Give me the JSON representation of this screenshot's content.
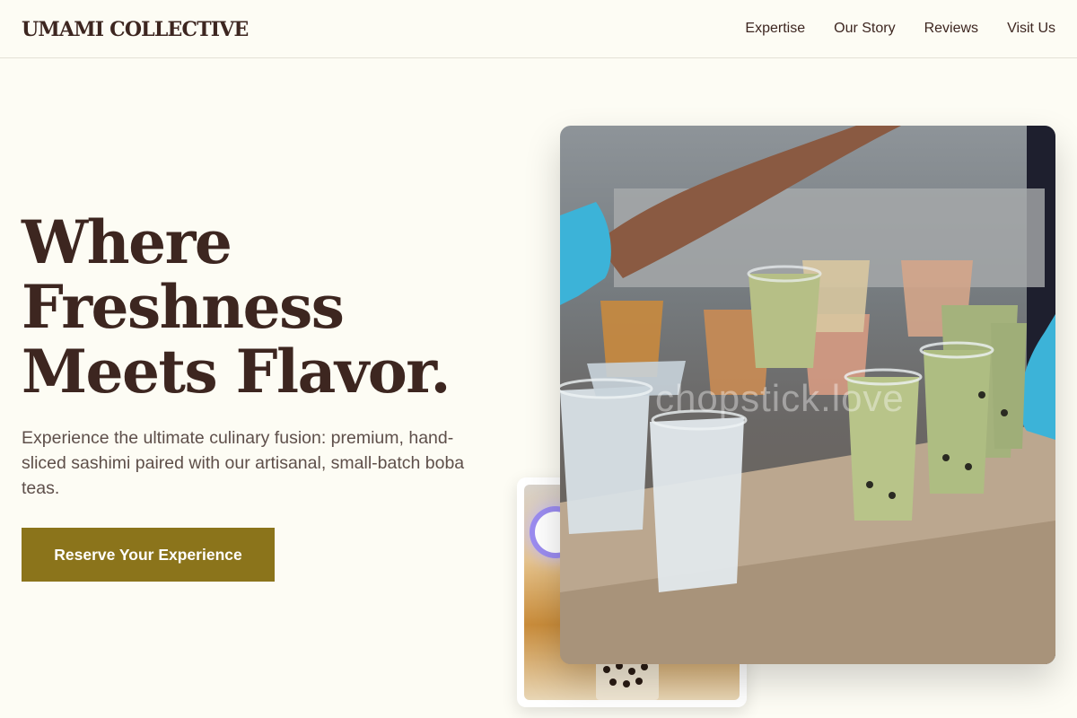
{
  "header": {
    "logo": "UMAMI COLLECTIVE",
    "nav": [
      "Expertise",
      "Our Story",
      "Reviews",
      "Visit Us"
    ]
  },
  "hero": {
    "title_lines": [
      "Where",
      "Freshness",
      "Meets Flavor."
    ],
    "description": "Experience the ultimate culinary fusion: premium, hand-sliced sashimi paired with our artisanal, small-batch boba teas.",
    "cta_label": "Reserve Your Experience",
    "main_image_watermark": "chopstick.love"
  },
  "colors": {
    "background": "#fdfcf4",
    "text_primary": "#3d2620",
    "text_secondary": "#5e4f4a",
    "accent": "#8b741b"
  }
}
